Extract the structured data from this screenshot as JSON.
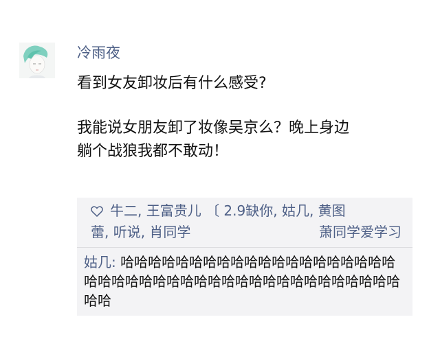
{
  "post": {
    "author": "冷雨夜",
    "question": "看到女友卸妆后有什么感受?",
    "answer_line1": "我能说女朋友卸了妆像吴京么？晚上身边",
    "answer_line2": "躺个战狼我都不敢动！"
  },
  "likes": {
    "icon": "heart-icon",
    "line1": "牛二, 王富贵儿 〔 2.9缺你, 姑几, 黄图",
    "line2_left": "蕾, 听说, 肖同学",
    "line2_right": "萧同学爱学习"
  },
  "comment": {
    "author": "姑几:",
    "text": "哈哈哈哈哈哈哈哈哈哈哈哈哈哈哈哈哈哈哈哈哈哈哈哈哈哈哈哈哈哈哈哈哈哈哈哈哈哈哈哈哈哈哈哈哈"
  },
  "colors": {
    "name_link": "#4d5f86",
    "comment_bg": "#f3f3f5"
  }
}
